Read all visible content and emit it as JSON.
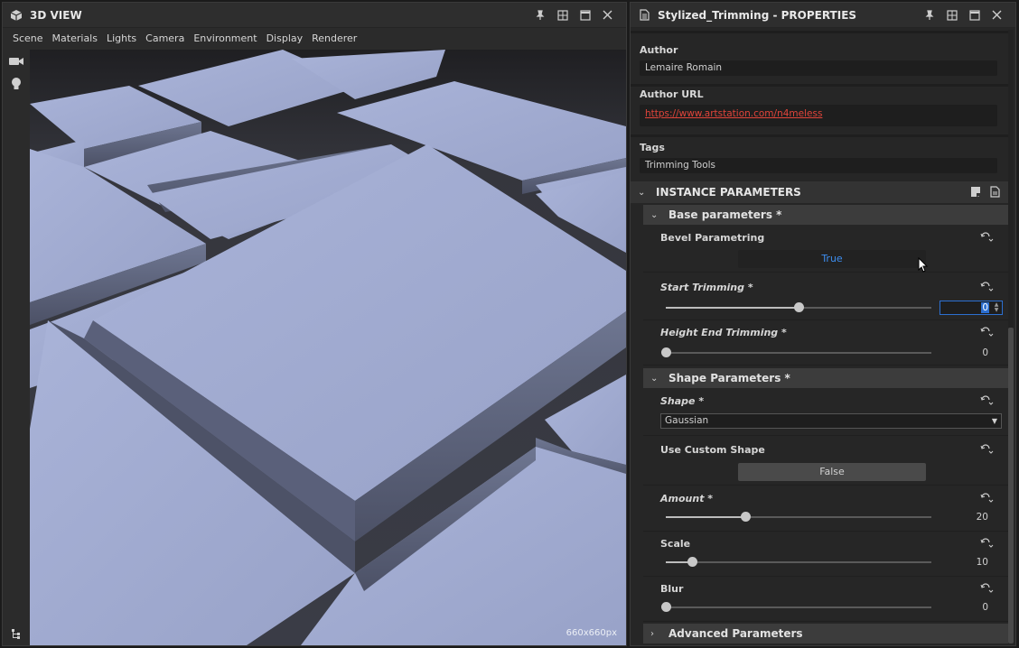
{
  "view": {
    "title": "3D VIEW",
    "menu": [
      "Scene",
      "Materials",
      "Lights",
      "Camera",
      "Environment",
      "Display",
      "Renderer"
    ],
    "size_label": "660x660px",
    "tools": [
      "camera-icon",
      "lightbulb-icon"
    ],
    "bottom_tool": "scene-tree-icon"
  },
  "properties": {
    "title": "Stylized_Trimming - PROPERTIES",
    "author_label": "Author",
    "author_value": "Lemaire Romain",
    "author_url_label": "Author URL",
    "author_url_value": "https://www.artstation.com/n4meless",
    "tags_label": "Tags",
    "tags_value": "Trimming Tools",
    "instance_section": "INSTANCE PARAMETERS",
    "base_section": "Base parameters *",
    "bevel_label": "Bevel Parametring",
    "bevel_value": "True",
    "start_label": "Start Trimming *",
    "start_value": "0",
    "start_level": 0.5,
    "height_label": "Height End Trimming *",
    "height_value": "0",
    "height_level": 0,
    "shape_section": "Shape Parameters *",
    "shape_label": "Shape *",
    "shape_value": "Gaussian",
    "custom_label": "Use Custom Shape",
    "custom_value": "False",
    "amount_label": "Amount *",
    "amount_value": "20",
    "amount_level": 0.3,
    "scale_label": "Scale",
    "scale_value": "10",
    "scale_level": 0.1,
    "blur_label": "Blur",
    "blur_value": "0",
    "blur_level": 0,
    "advanced_section": "Advanced Parameters"
  },
  "colors": {
    "accent": "#3d8ef0",
    "link": "#e0443a",
    "panel_bg": "#262626",
    "viewport_surface": "#9ea9cf"
  }
}
